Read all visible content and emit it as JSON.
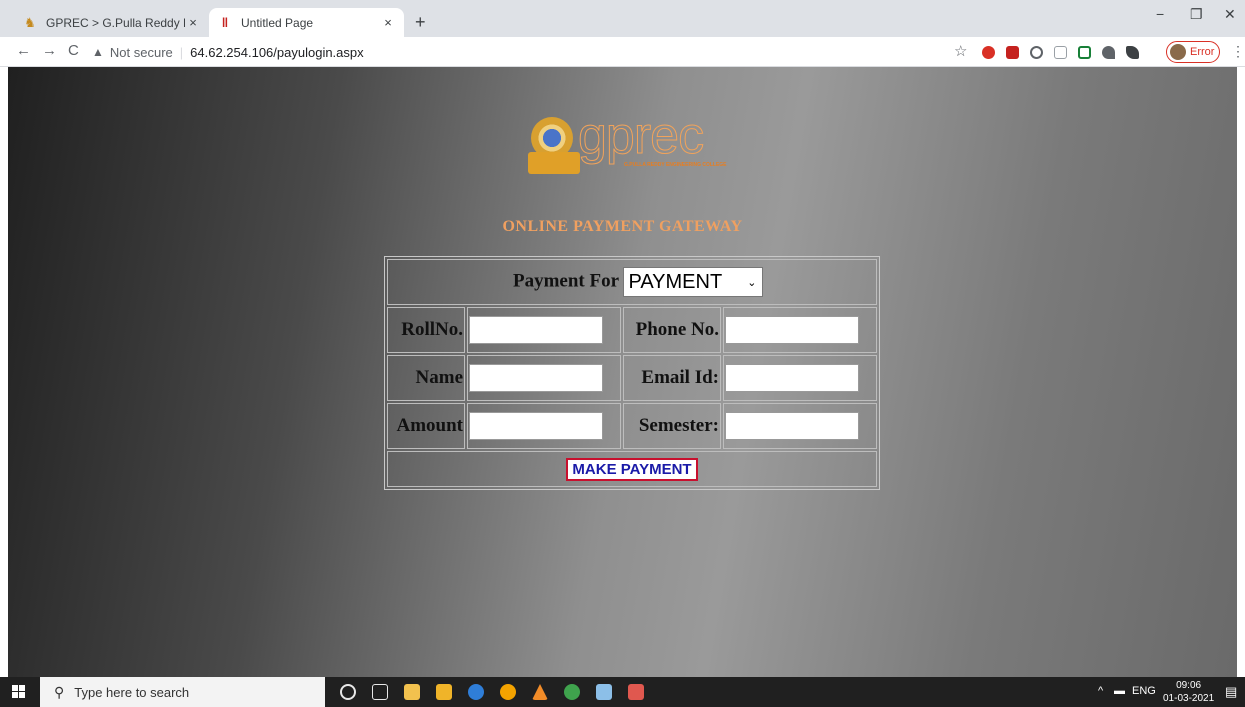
{
  "browser": {
    "tabs": [
      {
        "title": "GPREC > G.Pulla Reddy Engineer",
        "close": "×"
      },
      {
        "title": "Untitled Page",
        "close": "×"
      }
    ],
    "new_tab": "+",
    "window_controls": {
      "minimize": "−",
      "restore": "❐",
      "close": "✕"
    },
    "nav": {
      "back": "←",
      "forward": "→",
      "reload": "C"
    },
    "address": {
      "security_icon": "▲",
      "security_text": "Not secure",
      "url": "64.62.254.106/payulogin.aspx"
    },
    "bookmark_icon": "☆",
    "profile_label": "Error",
    "menu": "⋮",
    "extension_colors": [
      "#d93025",
      "#c5221f",
      "#5f6368",
      "#9aa0a6",
      "#188038",
      "#5f6368",
      "#3c4043"
    ]
  },
  "page": {
    "logo": {
      "wordmark": "gprec",
      "subtitle": "G.PULLA REDDY ENGINEERING COLLEGE"
    },
    "heading": "ONLINE PAYMENT GATEWAY",
    "form": {
      "payment_for_label": "Payment For",
      "payment_for_value": "PAYMENT",
      "rollno_label": "RollNo.",
      "phone_label": "Phone No.",
      "name_label": "Name",
      "email_label": "Email Id:",
      "amount_label": "Amount",
      "semester_label": "Semester:",
      "submit_label": "MAKE PAYMENT",
      "rollno_value": "",
      "phone_value": "",
      "name_value": "",
      "email_value": "",
      "amount_value": "",
      "semester_value": ""
    }
  },
  "taskbar": {
    "search_placeholder": "Type here to search",
    "tray": {
      "language": "ENG",
      "time": "09:06",
      "date": "01-03-2021"
    },
    "app_colors": [
      "#e8e8e8",
      "#e8e8e8",
      "#f2c14e",
      "#f0b429",
      "#2f7ed8",
      "#f4a300",
      "#f28c28",
      "#3fa34d",
      "#8cbfe8",
      "#e0584f"
    ]
  }
}
